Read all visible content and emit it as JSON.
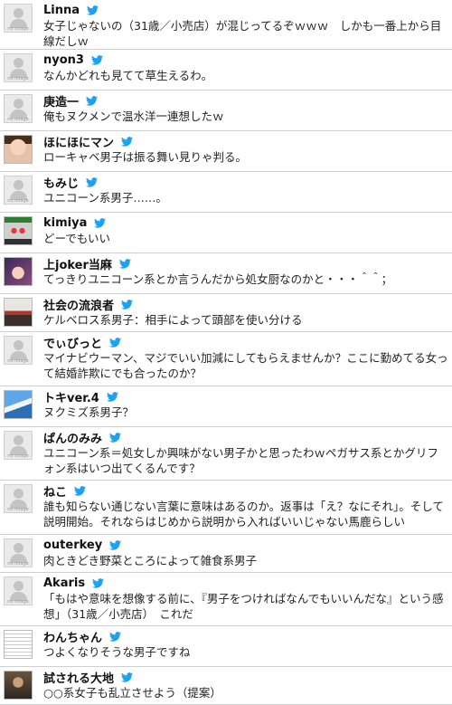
{
  "feed": {
    "accent": "#1da1f2",
    "items": [
      {
        "name": "Linna",
        "text": "女子じゃないの（31歳／小売店）が混じってるぞｗｗｗ　しかも一番上から目線だしｗ",
        "avatar": "no-image",
        "avatar_label": "no image"
      },
      {
        "name": "nyon3",
        "text": "なんかどれも見てて草生えるわ。",
        "avatar": "no-image",
        "avatar_label": "no image"
      },
      {
        "name": "庚造一",
        "text": "俺もヌクメンで温水洋一連想したｗ",
        "avatar": "no-image",
        "avatar_label": "no image"
      },
      {
        "name": "ほにほにマン",
        "text": "ローキャベ男子は振る舞い見りゃ判る。",
        "avatar": "anime-face",
        "avatar_label": ""
      },
      {
        "name": "もみじ",
        "text": "ユニコーン系男子……。",
        "avatar": "no-image",
        "avatar_label": "no image"
      },
      {
        "name": "kimiya",
        "text": "どーでもいい",
        "avatar": "hero-mask",
        "avatar_label": ""
      },
      {
        "name": "上joker当麻",
        "text": "てっきりユニコーン系とか言うんだから処女厨なのかと・・・＾＾；",
        "avatar": "anime-girl",
        "avatar_label": ""
      },
      {
        "name": "社会の流浪者",
        "text": "ケルベロス系男子：相手によって頭部を使い分ける",
        "avatar": "landscape",
        "avatar_label": ""
      },
      {
        "name": "でぃびっと",
        "text": "マイナビウーマン、マジでいい加減にしてもらえませんか？ここに勤めてる女って結婚詐欺にでも合ったのか？",
        "avatar": "no-image",
        "avatar_label": "no image"
      },
      {
        "name": "トキver.4",
        "text": "ヌクミズ系男子？",
        "avatar": "sky",
        "avatar_label": ""
      },
      {
        "name": "ぱんのみみ",
        "text": "ユニコーン系＝処女しか興味がない男子かと思ったわｗペガサス系とかグリフォン系はいつ出てくるんです？",
        "avatar": "no-image",
        "avatar_label": "no image"
      },
      {
        "name": "ねこ",
        "text": "誰も知らない通じない言葉に意味はあるのか。返事は「え？なにそれ」。そして説明開始。それならはじめから説明から入ればいいじゃない馬鹿らしい",
        "avatar": "no-image",
        "avatar_label": "no image"
      },
      {
        "name": "outerkey",
        "text": "肉ときどき野菜ところによって雑食系男子",
        "avatar": "no-image",
        "avatar_label": "no image"
      },
      {
        "name": "Akaris",
        "text": "「もはや意味を想像する前に、『男子をつければなんでもいいんだな』という感想」（31歳／小売店）　これだ",
        "avatar": "no-image",
        "avatar_label": "no image"
      },
      {
        "name": "わんちゃん",
        "text": "つよくなりそうな男子ですね",
        "avatar": "text-pattern",
        "avatar_label": ""
      },
      {
        "name": "試される大地",
        "text": "○○系女子も乱立させよう（提案）",
        "avatar": "person-photo",
        "avatar_label": ""
      }
    ]
  }
}
